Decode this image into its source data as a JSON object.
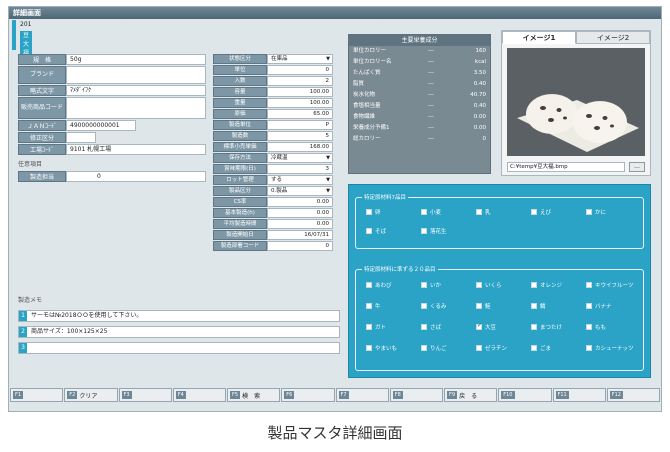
{
  "window": {
    "title": "詳細画面"
  },
  "product": {
    "code": "201",
    "chip": "豆大福"
  },
  "left_fields": [
    {
      "label": "規　格",
      "value": "50g"
    },
    {
      "label": "ブランド",
      "value": ""
    },
    {
      "label": "略式文字",
      "value": "ﾏﾒﾀﾞｲﾌｸ"
    },
    {
      "label": "販売商品コード",
      "value": ""
    },
    {
      "label": "ＪＡＮｺｰﾄﾞ",
      "value": "4900000000001"
    },
    {
      "label": "修正区分",
      "value": ""
    },
    {
      "label": "工場ｺｰﾄﾞ",
      "value": "9101 札幌工場"
    }
  ],
  "other_section": "任意項目",
  "qualification": {
    "label": "製造担当",
    "value": "0"
  },
  "mid_fields": [
    {
      "label": "状態区分",
      "value": "在庫品",
      "select": true
    },
    {
      "label": "単位",
      "value": "0"
    },
    {
      "label": "入数",
      "value": "2"
    },
    {
      "label": "容量",
      "value": "100.00"
    },
    {
      "label": "重量",
      "value": "100.00"
    },
    {
      "label": "原価",
      "value": "65.00"
    },
    {
      "label": "製造単位",
      "value": "P"
    },
    {
      "label": "製造数",
      "value": "5"
    },
    {
      "label": "標準小売単価",
      "value": "168.00"
    },
    {
      "label": "保存方法",
      "value": "冷蔵温",
      "select": true
    },
    {
      "label": "賞味期限(日)",
      "value": "3"
    },
    {
      "label": "ロット管理",
      "value": "する",
      "select": true
    },
    {
      "label": "製品区分",
      "value": "0.製品",
      "select": true
    },
    {
      "label": "CS率",
      "value": "0.00"
    },
    {
      "label": "基本製造(h)",
      "value": "0.00"
    },
    {
      "label": "平均製造時間",
      "value": "0.00"
    },
    {
      "label": "製造開始日",
      "value": "16/07/31"
    },
    {
      "label": "製造部署コード",
      "value": "0"
    }
  ],
  "nutrition": {
    "title": "主要栄養成分",
    "rows": [
      {
        "name": "単位カロリー",
        "dash": "---",
        "value": "160"
      },
      {
        "name": "単位カロリー名",
        "dash": "---",
        "value": "kcal"
      },
      {
        "name": "たんぱく質",
        "dash": "---",
        "value": "3.50"
      },
      {
        "name": "脂質",
        "dash": "---",
        "value": "0.40"
      },
      {
        "name": "炭水化物",
        "dash": "---",
        "value": "40.70"
      },
      {
        "name": "食塩相当量",
        "dash": "---",
        "value": "0.40"
      },
      {
        "name": "食物繊維",
        "dash": "---",
        "value": "0.00"
      },
      {
        "name": "栄養成分予備1",
        "dash": "---",
        "value": "0.00"
      },
      {
        "name": "総カロリー",
        "dash": "---",
        "value": "0"
      }
    ]
  },
  "image_panel": {
    "tabs": [
      "イメージ1",
      "イメージ2"
    ],
    "path": "C:¥temp¥豆大福.bmp",
    "browse": "..."
  },
  "allergens": {
    "required_title": "特定原材料7品目",
    "required": [
      {
        "label": "卵",
        "checked": false
      },
      {
        "label": "小麦",
        "checked": false
      },
      {
        "label": "乳",
        "checked": false
      },
      {
        "label": "えび",
        "checked": false
      },
      {
        "label": "かに",
        "checked": false
      },
      {
        "label": "そば",
        "checked": false
      },
      {
        "label": "落花生",
        "checked": false
      }
    ],
    "recommended_title": "特定原材料に準ずる２０品目",
    "recommended": [
      {
        "label": "あわび",
        "checked": false
      },
      {
        "label": "いか",
        "checked": false
      },
      {
        "label": "いくら",
        "checked": false
      },
      {
        "label": "オレンジ",
        "checked": false
      },
      {
        "label": "キウイフルーツ",
        "checked": false
      },
      {
        "label": "牛",
        "checked": false
      },
      {
        "label": "くるみ",
        "checked": false
      },
      {
        "label": "鮭",
        "checked": false
      },
      {
        "label": "鯖",
        "checked": false
      },
      {
        "label": "バナナ",
        "checked": false
      },
      {
        "label": "ガト",
        "checked": false
      },
      {
        "label": "さば",
        "checked": false
      },
      {
        "label": "大豆",
        "checked": true
      },
      {
        "label": "まつたけ",
        "checked": false
      },
      {
        "label": "もも",
        "checked": false
      },
      {
        "label": "やまいも",
        "checked": false
      },
      {
        "label": "りんご",
        "checked": false
      },
      {
        "label": "ゼラチン",
        "checked": false
      },
      {
        "label": "ごま",
        "checked": false
      },
      {
        "label": "カシューナッツ",
        "checked": false
      }
    ]
  },
  "notes": {
    "title": "製造メモ",
    "lines": [
      {
        "num": "1",
        "text": "サーモは№2018ＯＯを使用して下さい。"
      },
      {
        "num": "2",
        "text": "商品サイズ：100×125×25"
      },
      {
        "num": "3",
        "text": ""
      }
    ]
  },
  "function_keys": [
    {
      "key": "F1",
      "label": ""
    },
    {
      "key": "F2",
      "label": "クリア"
    },
    {
      "key": "F3",
      "label": ""
    },
    {
      "key": "F4",
      "label": ""
    },
    {
      "key": "F5",
      "label": "検　索"
    },
    {
      "key": "F6",
      "label": ""
    },
    {
      "key": "F7",
      "label": ""
    },
    {
      "key": "F8",
      "label": ""
    },
    {
      "key": "F9",
      "label": "戻　る"
    },
    {
      "key": "F10",
      "label": ""
    },
    {
      "key": "F11",
      "label": ""
    },
    {
      "key": "F12",
      "label": ""
    }
  ],
  "caption": "製品マスタ詳細画面",
  "colors": {
    "accent": "#2aa3c6",
    "label_bg": "#7d97a6",
    "panel_gray": "#7a8a93"
  }
}
